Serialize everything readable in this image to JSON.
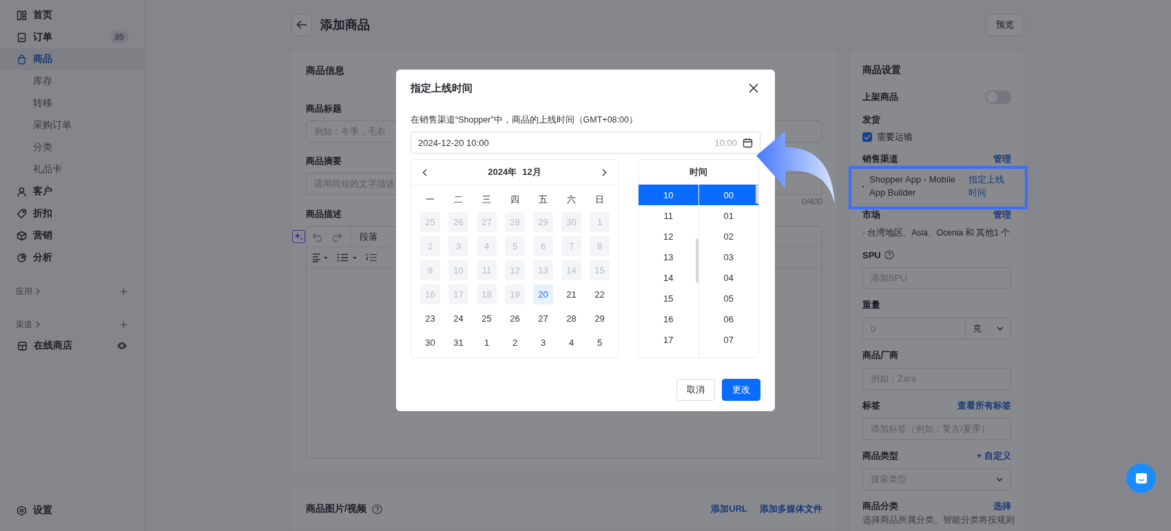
{
  "sidebar": {
    "nav": [
      {
        "label": "首页",
        "selected": false
      },
      {
        "label": "订单",
        "selected": false,
        "badge": "89"
      },
      {
        "label": "商品",
        "selected": true,
        "children": [
          {
            "label": "库存",
            "selected": false
          },
          {
            "label": "转移",
            "selected": false
          },
          {
            "label": "采购订单",
            "selected": false
          },
          {
            "label": "分类",
            "selected": false
          },
          {
            "label": "礼品卡",
            "selected": false
          }
        ]
      },
      {
        "label": "客户",
        "selected": false
      },
      {
        "label": "折扣",
        "selected": false
      },
      {
        "label": "营销",
        "selected": false
      },
      {
        "label": "分析",
        "selected": false
      }
    ],
    "sections": [
      {
        "label": "应用"
      },
      {
        "label": "渠道",
        "items": [
          {
            "label": "在线商店"
          }
        ]
      }
    ],
    "settings": {
      "label": "设置"
    }
  },
  "header": {
    "title": "添加商品",
    "preview_button": "预览"
  },
  "product_info": {
    "title": "商品信息",
    "fields": [
      {
        "label": "商品标题",
        "placeholder": "例如：冬季，毛衣"
      },
      {
        "label": "商品摘要",
        "placeholder": "请用简短的文字描述",
        "counter": "0/400"
      }
    ],
    "description": {
      "label": "商品描述",
      "block_style": "段落"
    }
  },
  "media": {
    "title": "商品图片/视频",
    "links": [
      "添加URL",
      "添加多媒体文件"
    ]
  },
  "settings_panel": {
    "title": "商品设置",
    "publish": {
      "label": "上架商品",
      "on": false
    },
    "shipping": {
      "label": "发货",
      "option": "需要运输",
      "checked": true
    },
    "channels": {
      "label": "销售渠道",
      "action": "管理",
      "items": [
        {
          "name": "Shopper App - Mobile App Builder",
          "action": "指定上线时间"
        }
      ]
    },
    "markets": {
      "label": "市场",
      "action": "管理",
      "summary": "· 台湾地区、Asia、Ocenia 和 其他1 个"
    },
    "spu": {
      "label": "SPU",
      "placeholder": "添加SPU"
    },
    "weight": {
      "label": "重量",
      "placeholder": "0",
      "unit": "克"
    },
    "vendor": {
      "label": "商品厂商",
      "placeholder": "例如：Zara"
    },
    "tags": {
      "label": "标签",
      "action": "查看所有标签",
      "placeholder": "添加标签（例如：复古/夏季）"
    },
    "type": {
      "label": "商品类型",
      "action": "+ 自定义",
      "placeholder": "搜索类型"
    },
    "category": {
      "label": "商品分类",
      "action": "选择",
      "hint": "选择商品所属分类。智能分类将按规则"
    }
  },
  "modal": {
    "title": "指定上线时间",
    "subtitle": "在销售渠道“Shopper”中，商品的上线时间（GMT+08:00）",
    "value": "2024-12-20 10:00",
    "time_hint": "10:00",
    "calendar": {
      "year": "2024年",
      "month": "12月",
      "weekdays": [
        "一",
        "二",
        "三",
        "四",
        "五",
        "六",
        "日"
      ],
      "days": [
        {
          "day": "25",
          "disabled": true,
          "selected": false
        },
        {
          "day": "26",
          "disabled": true,
          "selected": false
        },
        {
          "day": "27",
          "disabled": true,
          "selected": false
        },
        {
          "day": "28",
          "disabled": true,
          "selected": false
        },
        {
          "day": "29",
          "disabled": true,
          "selected": false
        },
        {
          "day": "30",
          "disabled": true,
          "selected": false
        },
        {
          "day": "1",
          "disabled": true,
          "selected": false
        },
        {
          "day": "2",
          "disabled": true,
          "selected": false
        },
        {
          "day": "3",
          "disabled": true,
          "selected": false
        },
        {
          "day": "4",
          "disabled": true,
          "selected": false
        },
        {
          "day": "5",
          "disabled": true,
          "selected": false
        },
        {
          "day": "6",
          "disabled": true,
          "selected": false
        },
        {
          "day": "7",
          "disabled": true,
          "selected": false
        },
        {
          "day": "8",
          "disabled": true,
          "selected": false
        },
        {
          "day": "9",
          "disabled": true,
          "selected": false
        },
        {
          "day": "10",
          "disabled": true,
          "selected": false
        },
        {
          "day": "11",
          "disabled": true,
          "selected": false
        },
        {
          "day": "12",
          "disabled": true,
          "selected": false
        },
        {
          "day": "13",
          "disabled": true,
          "selected": false
        },
        {
          "day": "14",
          "disabled": true,
          "selected": false
        },
        {
          "day": "15",
          "disabled": true,
          "selected": false
        },
        {
          "day": "16",
          "disabled": true,
          "selected": false
        },
        {
          "day": "17",
          "disabled": true,
          "selected": false
        },
        {
          "day": "18",
          "disabled": true,
          "selected": false
        },
        {
          "day": "19",
          "disabled": true,
          "selected": false
        },
        {
          "day": "20",
          "disabled": false,
          "selected": true
        },
        {
          "day": "21",
          "disabled": false,
          "selected": false
        },
        {
          "day": "22",
          "disabled": false,
          "selected": false
        },
        {
          "day": "23",
          "disabled": false,
          "selected": false
        },
        {
          "day": "24",
          "disabled": false,
          "selected": false
        },
        {
          "day": "25",
          "disabled": false,
          "selected": false
        },
        {
          "day": "26",
          "disabled": false,
          "selected": false
        },
        {
          "day": "27",
          "disabled": false,
          "selected": false
        },
        {
          "day": "28",
          "disabled": false,
          "selected": false
        },
        {
          "day": "29",
          "disabled": false,
          "selected": false
        },
        {
          "day": "30",
          "disabled": false,
          "selected": false
        },
        {
          "day": "31",
          "disabled": false,
          "selected": false
        },
        {
          "day": "1",
          "disabled": false,
          "selected": false
        },
        {
          "day": "2",
          "disabled": false,
          "selected": false
        },
        {
          "day": "3",
          "disabled": false,
          "selected": false
        },
        {
          "day": "4",
          "disabled": false,
          "selected": false
        },
        {
          "day": "5",
          "disabled": false,
          "selected": false
        }
      ]
    },
    "time": {
      "title": "时间",
      "hours": [
        {
          "label": "10",
          "selected": true
        },
        {
          "label": "11",
          "selected": false
        },
        {
          "label": "12",
          "selected": false
        },
        {
          "label": "13",
          "selected": false
        },
        {
          "label": "14",
          "selected": false
        },
        {
          "label": "15",
          "selected": false
        },
        {
          "label": "16",
          "selected": false
        },
        {
          "label": "17",
          "selected": false
        }
      ],
      "minutes": [
        {
          "label": "00",
          "selected": true
        },
        {
          "label": "01",
          "selected": false
        },
        {
          "label": "02",
          "selected": false
        },
        {
          "label": "03",
          "selected": false
        },
        {
          "label": "04",
          "selected": false
        },
        {
          "label": "05",
          "selected": false
        },
        {
          "label": "06",
          "selected": false
        },
        {
          "label": "07",
          "selected": false
        }
      ]
    },
    "buttons": {
      "cancel": "取消",
      "confirm": "更改"
    }
  }
}
